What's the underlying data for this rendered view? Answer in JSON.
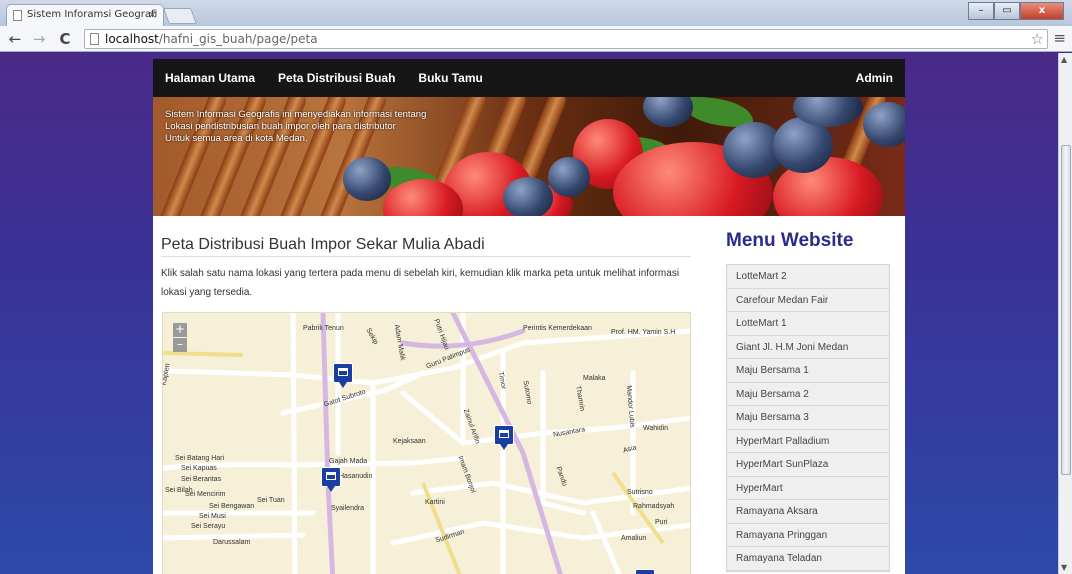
{
  "browser": {
    "tab_title": "Sistem Inforamsi Geografi",
    "tab_close": "×",
    "url_host": "localhost",
    "url_path": "/hafni_gis_buah/page/peta",
    "back_icon": "←",
    "forward_icon": "→",
    "reload_icon": "C",
    "star_icon": "☆",
    "menu_icon": "≡",
    "minimize": "–",
    "maximize": "▭",
    "close": "x"
  },
  "nav": {
    "home": "Halaman Utama",
    "map": "Peta Distribusi Buah",
    "guestbook": "Buku Tamu",
    "admin": "Admin"
  },
  "banner": {
    "line1": "Sistem Informasi Geografis ini menyediakan informasi tentang",
    "line2": "Lokasi pendistribusian buah impor oleh para distributor",
    "line3": "Untuk semua area di kota Medan."
  },
  "content": {
    "title": "Peta Distribusi Buah Impor Sekar Mulia Abadi",
    "description": "Klik salah satu nama lokasi yang tertera pada menu di sebelah kiri, kemudian klik marka peta untuk melihat informasi lokasi yang tersedia."
  },
  "map": {
    "zoom_in": "+",
    "zoom_out": "–",
    "labels": [
      "Pabrik Tenun",
      "Sekip",
      "Adam Malik",
      "Putri Hijau",
      "Gatot Subroto",
      "Guru Patimpus",
      "Perintis Kemerdekaan",
      "Prof. HM. Yamin S.H",
      "Malaka",
      "Timor",
      "Sutomo",
      "Thamrin",
      "Mandor Lubis",
      "Wahidin",
      "Kejaksaan",
      "Nusantara",
      "Asia",
      "Gajah Mada",
      "Sei Batang Hari",
      "Sei Kapuas",
      "Sei Berantas",
      "Sei Bilah",
      "Sei Mencirim",
      "Sei Tuan",
      "Sei Bengawan",
      "Sei Musi",
      "Sei Serayu",
      "Darussalam",
      "Kartini",
      "Syailendra",
      "Sudirman",
      "Pandu",
      "Sutrisno",
      "Rahmadsyah",
      "Puri",
      "Amaliun",
      "Hasanudin",
      "Imam Bonjol",
      "Kapten",
      "Zainul Arifin"
    ]
  },
  "sidebar": {
    "title": "Menu Website",
    "items": [
      "LotteMart 2",
      "Carefour Medan Fair",
      "LotteMart 1",
      "Giant Jl. H.M Joni Medan",
      "Maju Bersama 1",
      "Maju Bersama 2",
      "Maju Bersama 3",
      "HyperMart Palladium",
      "HyperMart SunPlaza",
      "HyperMart",
      "Ramayana Aksara",
      "Ramayana Pringgan",
      "Ramayana Teladan"
    ]
  }
}
